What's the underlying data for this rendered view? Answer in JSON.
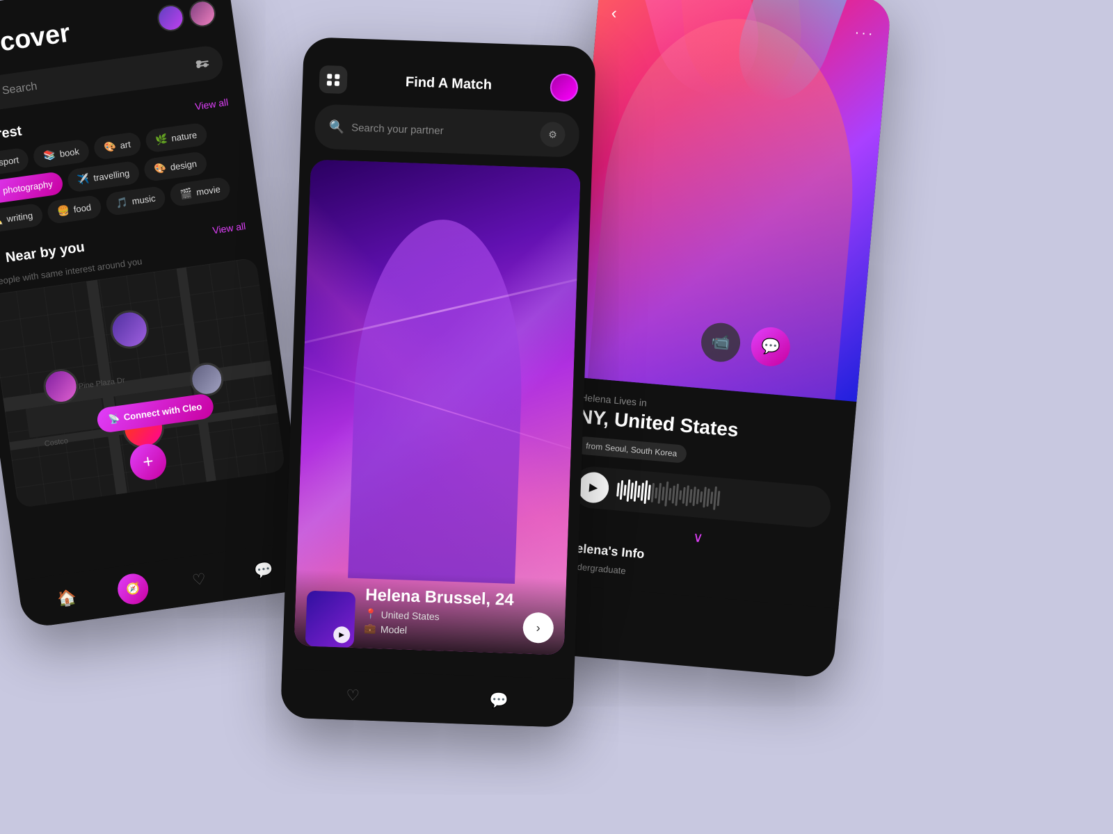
{
  "app": {
    "bg_color": "#c8c8e0"
  },
  "phone1": {
    "title": "Discover",
    "search_placeholder": "Search",
    "view_all_1": "View all",
    "view_all_2": "View all",
    "interest_title": "Interest",
    "tags": [
      {
        "label": "sport",
        "emoji": "⚽",
        "active": false
      },
      {
        "label": "book",
        "emoji": "📚",
        "active": false
      },
      {
        "label": "art",
        "emoji": "🎨",
        "active": false
      },
      {
        "label": "nature",
        "emoji": "🌿",
        "active": false
      },
      {
        "label": "photography",
        "emoji": "📷",
        "active": true
      },
      {
        "label": "travelling",
        "emoji": "✈️",
        "active": false
      },
      {
        "label": "design",
        "emoji": "🎨",
        "active": false
      },
      {
        "label": "writing",
        "emoji": "✏️",
        "active": false
      },
      {
        "label": "food",
        "emoji": "🍔",
        "active": false
      },
      {
        "label": "music",
        "emoji": "🎵",
        "active": false
      },
      {
        "label": "movie",
        "emoji": "🎬",
        "active": false
      }
    ],
    "nearby_title": "Near by you",
    "nearby_subtitle": "People with same interest around you",
    "map_label_1": "Pine Plaza Dr",
    "map_label_2": "Costco",
    "connect_btn": "Connect with Cleo"
  },
  "phone2": {
    "title": "Find A Match",
    "search_placeholder": "Search your partner",
    "card": {
      "name": "Helena Brussel, 24",
      "location": "United States",
      "profession": "Model"
    }
  },
  "phone3": {
    "lives_label": "Helena Lives in",
    "location": "NY, United States",
    "from_badge": "from Seoul, South Korea",
    "helena_info": "Helena's Info",
    "undergrad": "Undergraduate"
  }
}
